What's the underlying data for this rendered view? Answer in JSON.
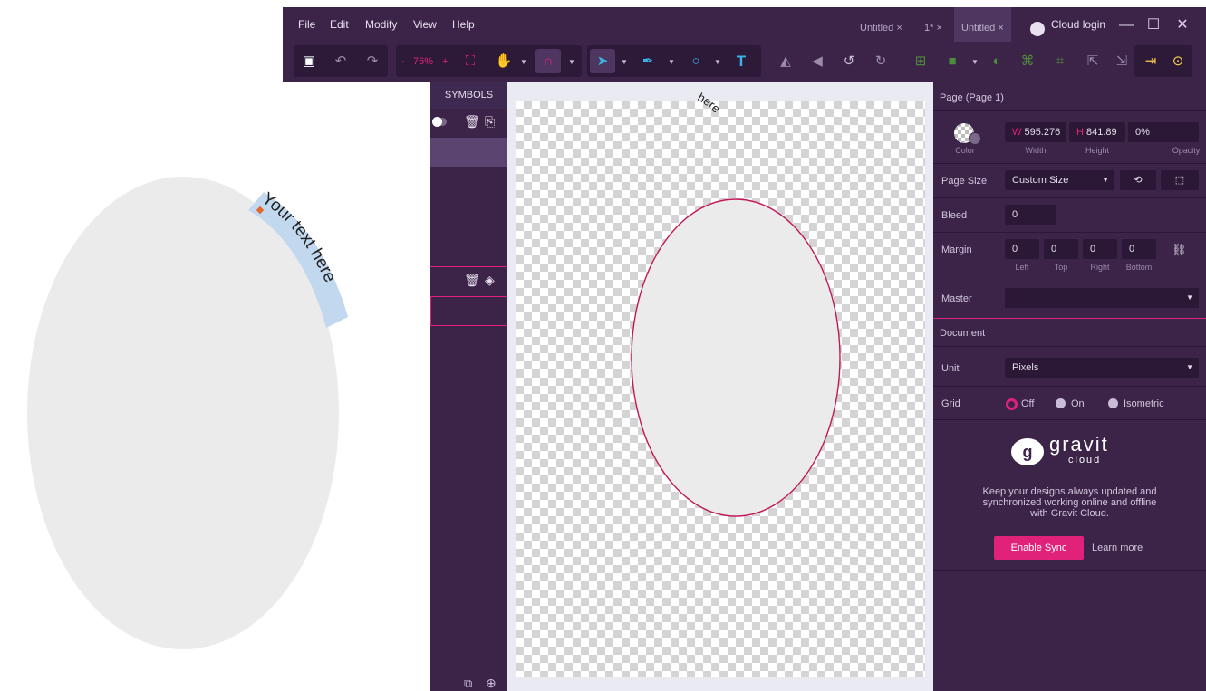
{
  "menubar": {
    "items": [
      "File",
      "Edit",
      "Modify",
      "View",
      "Help"
    ]
  },
  "tabs": [
    {
      "label": "Untitled ×"
    },
    {
      "label": "1* ×"
    },
    {
      "label": "Untitled ×"
    }
  ],
  "cloud_login": "Cloud login",
  "window_controls": {
    "minimize": "—",
    "maximize": "☐",
    "close": "✕"
  },
  "toolbar": {
    "zoom_minus": "-",
    "zoom_value": "76%",
    "zoom_plus": "+"
  },
  "left_canvas": {
    "curved_text": "Your text here"
  },
  "artboard": {
    "curved_text_fragment": "here"
  },
  "symbols_panel": {
    "header": "SYMBOLS"
  },
  "properties": {
    "section_title": "Page (Page 1)",
    "color_label": "Color",
    "width": {
      "prefix": "W",
      "value": "595.276",
      "label": "Width"
    },
    "height": {
      "prefix": "H",
      "value": "841.89",
      "label": "Height"
    },
    "opacity": {
      "value": "0%",
      "label": "Opacity"
    },
    "page_size": {
      "label": "Page Size",
      "value": "Custom Size"
    },
    "bleed": {
      "label": "Bleed",
      "value": "0"
    },
    "margin": {
      "label": "Margin",
      "left": {
        "value": "0",
        "label": "Left"
      },
      "top": {
        "value": "0",
        "label": "Top"
      },
      "right": {
        "value": "0",
        "label": "Right"
      },
      "bottom": {
        "value": "0",
        "label": "Bottom"
      }
    },
    "master": {
      "label": "Master",
      "value": ""
    },
    "document_title": "Document",
    "unit": {
      "label": "Unit",
      "value": "Pixels"
    },
    "grid": {
      "label": "Grid",
      "options": [
        {
          "label": "Off",
          "selected": true
        },
        {
          "label": "On",
          "selected": false
        },
        {
          "label": "Isometric",
          "selected": false
        }
      ]
    },
    "cloud": {
      "brand": "gravit",
      "brand_sub": "cloud",
      "message_line1": "Keep your designs always updated and",
      "message_line2": "synchronized working online and offline",
      "message_line3": "with Gravit Cloud.",
      "enable_button": "Enable Sync",
      "learn_more": "Learn more"
    }
  },
  "colors": {
    "panel_bg": "#3b2448",
    "field_bg": "#2a1836",
    "accent_pink": "#e0227a",
    "ellipse_fill": "#ebebeb",
    "text_highlight": "#c2d8ee"
  }
}
